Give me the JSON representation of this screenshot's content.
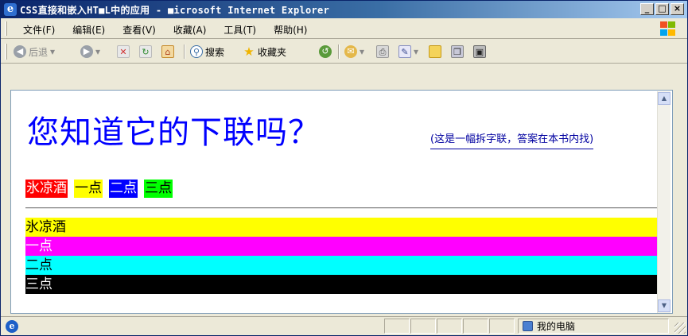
{
  "window": {
    "title": "CSS直接和嵌入HT■L中的应用 - ■icrosoft Internet Explorer",
    "buttons": {
      "minimize": "_",
      "maximize": "□",
      "close": "×"
    }
  },
  "menu": {
    "items": [
      "文件(F)",
      "编辑(E)",
      "查看(V)",
      "收藏(A)",
      "工具(T)",
      "帮助(H)"
    ]
  },
  "toolbar": {
    "back_label": "后退",
    "search_label": "搜索",
    "favorites_label": "收藏夹"
  },
  "page": {
    "heading": "您知道它的下联吗？",
    "hint": "(这是一幅拆字联，答案在本书内找)",
    "tags": [
      {
        "label": "氷凉酒",
        "bg": "#ff0000",
        "color": "#ffffff"
      },
      {
        "label": "一点",
        "bg": "#ffff00",
        "color": "#000000"
      },
      {
        "label": "二点",
        "bg": "#0000ff",
        "color": "#ffffff"
      },
      {
        "label": "三点",
        "bg": "#00ff00",
        "color": "#000000"
      }
    ],
    "bars": [
      {
        "label": "氷凉酒",
        "bg": "#ffff00",
        "color": "#000000"
      },
      {
        "label": "一点",
        "bg": "#ff00ff",
        "color": "#ffffff"
      },
      {
        "label": "二点",
        "bg": "#00ffff",
        "color": "#000000"
      },
      {
        "label": "三点",
        "bg": "#000000",
        "color": "#ffffff"
      }
    ]
  },
  "status": {
    "zone": "我的电脑"
  }
}
